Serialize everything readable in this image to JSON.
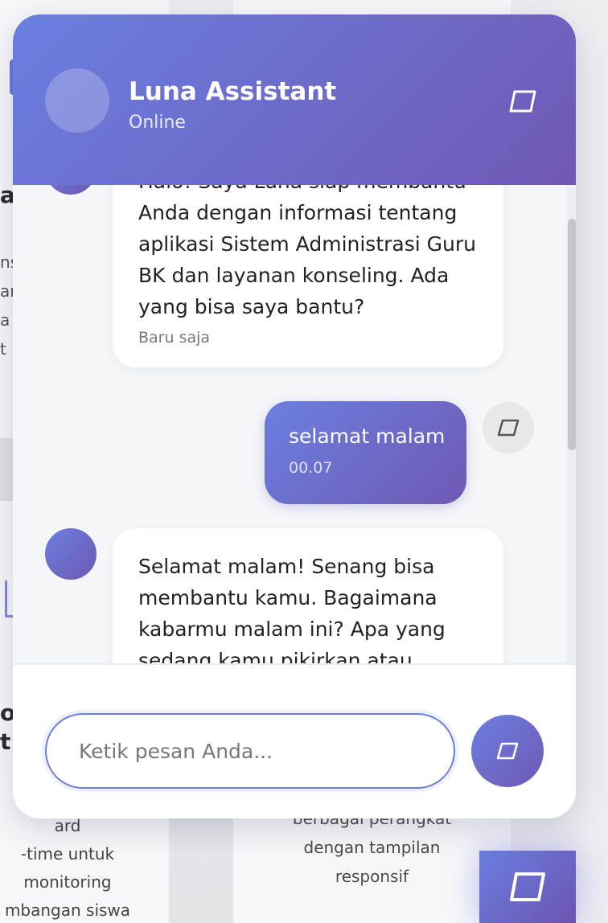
{
  "background": {
    "heading_left_top": "a",
    "heading_left_bottom_1": "or",
    "heading_left_bottom_2": "t",
    "snippet_lines": [
      "ns",
      "an",
      "a",
      "t"
    ],
    "card_left_desc": [
      "ard",
      "-time untuk",
      "monitoring",
      "mbangan siswa"
    ],
    "card_right_desc": [
      "berbagai perangkat",
      "dengan tampilan",
      "responsif"
    ]
  },
  "chat": {
    "header": {
      "title": "Luna Assistant",
      "status": "Online"
    },
    "messages": [
      {
        "sender": "bot",
        "text": "Halo! Saya Luna siap membantu Anda dengan informasi tentang aplikasi Sistem Administrasi Guru BK dan layanan konseling. Ada yang bisa saya bantu?",
        "time": "Baru saja"
      },
      {
        "sender": "user",
        "text": "selamat malam",
        "time": "00.07"
      },
      {
        "sender": "bot",
        "text": "Selamat malam! Senang bisa membantu kamu. Bagaimana kabarmu malam ini? Apa yang sedang kamu pikirkan atau"
      }
    ],
    "input": {
      "placeholder": "Ketik pesan Anda..."
    }
  },
  "colors": {
    "accent_start": "#6a7fe0",
    "accent_end": "#7058b4",
    "message_area_bg": "#f5f6f9"
  },
  "icons": {
    "close": "square-outline-icon",
    "user_avatar": "square-outline-icon",
    "send": "square-outline-icon",
    "floating_toggle": "square-outline-icon"
  }
}
